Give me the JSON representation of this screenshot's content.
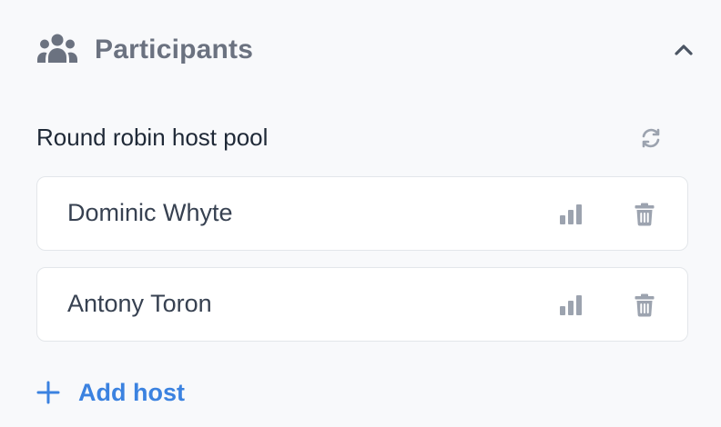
{
  "section": {
    "title": "Participants",
    "icon": "people-group-icon",
    "collapse_icon": "chevron-up-icon"
  },
  "pool": {
    "label": "Round robin host pool",
    "refresh_icon": "refresh-icon"
  },
  "hosts": [
    {
      "name": "Dominic Whyte",
      "stats_icon": "bar-chart-icon",
      "delete_icon": "trash-icon"
    },
    {
      "name": "Antony Toron",
      "stats_icon": "bar-chart-icon",
      "delete_icon": "trash-icon"
    }
  ],
  "add_host": {
    "label": "Add host",
    "icon": "plus-icon"
  },
  "colors": {
    "background": "#f8f9fb",
    "title": "#6b7280",
    "icon_gray": "#9ca3af",
    "accent": "#3b82e0",
    "card_border": "#e3e6ea"
  }
}
